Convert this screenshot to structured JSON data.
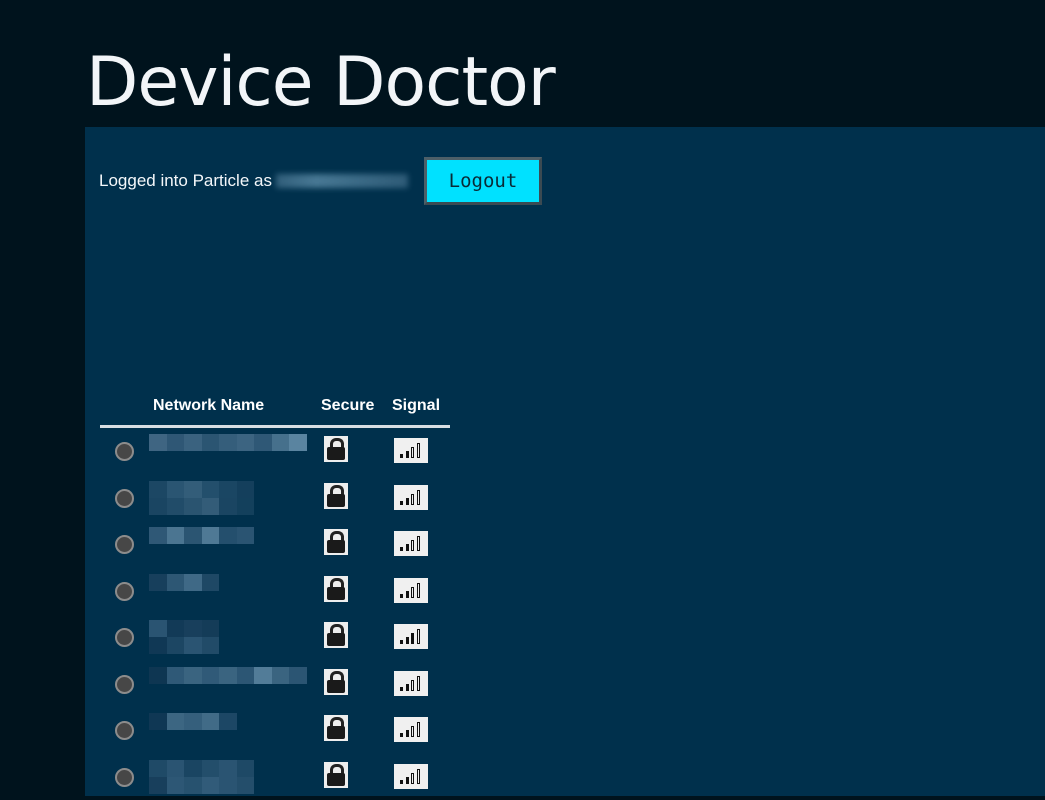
{
  "app": {
    "title": "Device Doctor"
  },
  "login": {
    "text": "Logged into Particle as",
    "logout_label": "Logout"
  },
  "table": {
    "headers": {
      "name": "Network Name",
      "secure": "Secure",
      "signal": "Signal"
    },
    "networks": [
      {
        "secure": true,
        "signal_bars": 2
      },
      {
        "secure": true,
        "signal_bars": 2
      },
      {
        "secure": true,
        "signal_bars": 2
      },
      {
        "secure": true,
        "signal_bars": 2
      },
      {
        "secure": true,
        "signal_bars": 3
      },
      {
        "secure": true,
        "signal_bars": 2
      },
      {
        "secure": true,
        "signal_bars": 2
      },
      {
        "secure": true,
        "signal_bars": 2
      }
    ]
  },
  "colors": {
    "background": "#00131d",
    "panel": "#00304c",
    "accent": "#00e1ff"
  }
}
